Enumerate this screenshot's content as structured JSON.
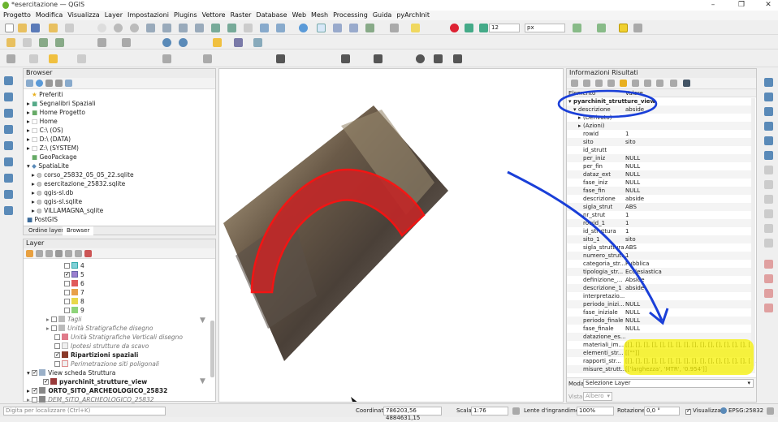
{
  "window": {
    "title": "*esercitazione — QGIS",
    "minimize": "–",
    "restore": "❐",
    "close": "✕"
  },
  "menu": [
    "Progetto",
    "Modifica",
    "Visualizza",
    "Layer",
    "Impostazioni",
    "Plugins",
    "Vettore",
    "Raster",
    "Database",
    "Web",
    "Mesh",
    "Processing",
    "Guida",
    "pyArchInit"
  ],
  "toolbar": {
    "font_size": "12",
    "unit": "px"
  },
  "browser": {
    "title": "Browser",
    "items": [
      {
        "label": "Preferiti",
        "icon": "star-icon"
      },
      {
        "label": "Segnalibri Spaziali",
        "icon": "bookmark-icon"
      },
      {
        "label": "Home Progetto",
        "icon": "home-project-icon"
      },
      {
        "label": "Home",
        "icon": "folder-icon"
      },
      {
        "label": "C:\\ (OS)",
        "icon": "drive-icon"
      },
      {
        "label": "D:\\ (DATA)",
        "icon": "drive-icon"
      },
      {
        "label": "Z:\\ (SYSTEM)",
        "icon": "drive-icon"
      },
      {
        "label": "GeoPackage",
        "icon": "geopackage-icon"
      },
      {
        "label": "SpatiaLite",
        "icon": "spatialite-icon"
      },
      {
        "label": "corso_25832_05_05_22.sqlite",
        "icon": "db-icon"
      },
      {
        "label": "esercitazione_25832.sqlite",
        "icon": "db-icon"
      },
      {
        "label": "qgis-sl.db",
        "icon": "db-icon"
      },
      {
        "label": "qgis-sl.sqlite",
        "icon": "db-icon"
      },
      {
        "label": "VILLAMAGNA_sqlite",
        "icon": "db-icon"
      },
      {
        "label": "PostGIS",
        "icon": "postgis-icon"
      }
    ],
    "tabs": [
      "Ordine layer",
      "Browser"
    ]
  },
  "layers": {
    "title": "Layer",
    "items": [
      {
        "label": "4",
        "color": "#7fd0d8",
        "checked": false
      },
      {
        "label": "5",
        "color": "#9b7fd0",
        "checked": true
      },
      {
        "label": "6",
        "color": "#e05a5a",
        "checked": false
      },
      {
        "label": "7",
        "color": "#e8a04a",
        "checked": false
      },
      {
        "label": "8",
        "color": "#e8d84a",
        "checked": false
      },
      {
        "label": "9",
        "color": "#8ed47a",
        "checked": false
      },
      {
        "label": "Tagli",
        "color": "#bbbbbb",
        "checked": false
      },
      {
        "label": "Unità Stratigrafiche disegno",
        "color": "#bbbbbb",
        "checked": false
      },
      {
        "label": "Unità Stratigrafiche Verticali disegno",
        "color": "#e07a8a",
        "checked": false
      },
      {
        "label": "Ipotesi strutture da scavo",
        "color": "#f0f0f0",
        "checked": false
      },
      {
        "label": "Ripartizioni spaziali",
        "color": "#8a3a2a",
        "checked": true
      },
      {
        "label": "Perimetrazione siti poligonali",
        "color": "#f0f0f0",
        "checked": false
      },
      {
        "label": "View scheda Struttura",
        "color": "#9ab0c8",
        "checked": true
      },
      {
        "label": "pyarchinit_strutture_view",
        "color": "#9a3a3a",
        "checked": true
      },
      {
        "label": "ORTO_SITO_ARCHEOLOGICO_25832",
        "color": "#888888",
        "checked": false
      },
      {
        "label": "DEM_SITO_ARCHEOLOGICO_25832",
        "color": "#888888",
        "checked": false
      }
    ]
  },
  "results": {
    "title": "Informazioni Risultati",
    "col_element": "Elemento",
    "col_value": "Valore",
    "layer": "pyarchinit_strutture_view",
    "first": {
      "k": "descrizione",
      "v": "abside"
    },
    "derived": "(Derivato)",
    "actions": "(Azioni)",
    "rows": [
      {
        "k": "rowid",
        "v": "1"
      },
      {
        "k": "sito",
        "v": "sito"
      },
      {
        "k": "id_strutt",
        "v": ""
      },
      {
        "k": "per_iniz",
        "v": "NULL"
      },
      {
        "k": "per_fin",
        "v": "NULL"
      },
      {
        "k": "dataz_ext",
        "v": "NULL"
      },
      {
        "k": "fase_iniz",
        "v": "NULL"
      },
      {
        "k": "fase_fin",
        "v": "NULL"
      },
      {
        "k": "descrizione",
        "v": "abside"
      },
      {
        "k": "sigla_strut",
        "v": "ABS"
      },
      {
        "k": "nr_strut",
        "v": "1"
      },
      {
        "k": "rowid_1",
        "v": "1"
      },
      {
        "k": "id_struttura",
        "v": "1"
      },
      {
        "k": "sito_1",
        "v": "sito"
      },
      {
        "k": "sigla_struttura",
        "v": "ABS"
      },
      {
        "k": "numero_strut...",
        "v": "1"
      },
      {
        "k": "categoria_str...",
        "v": "Pubblica"
      },
      {
        "k": "tipologia_str...",
        "v": "Ecclesiastica"
      },
      {
        "k": "definizione_...",
        "v": "Abside"
      },
      {
        "k": "descrizione_1",
        "v": "abside"
      },
      {
        "k": "interpretazio...",
        "v": ""
      },
      {
        "k": "periodo_inizi...",
        "v": "NULL"
      },
      {
        "k": "fase_iniziale",
        "v": "NULL"
      },
      {
        "k": "periodo_finale",
        "v": "NULL"
      },
      {
        "k": "fase_finale",
        "v": "NULL"
      },
      {
        "k": "datazione_es...",
        "v": ""
      },
      {
        "k": "materiali_im...",
        "v": "[[], [], [], [], [], [], [], [], [], [], [], [], [], [], [], [], [..."
      },
      {
        "k": "elementi_str...",
        "v": "[[\"\"]]"
      },
      {
        "k": "rapporti_str...",
        "v": "[[], [], [], [], [], [], [], [], [], [], [], [], [], [], [], [..."
      },
      {
        "k": "misure_strutt...",
        "v": "[['larghezza', 'MTR', '0.954']]"
      }
    ],
    "mode_label": "Moda",
    "mode_value": "Selezione Layer",
    "view_label": "Vista",
    "view_value": "Albero"
  },
  "status": {
    "search_placeholder": "Digita per localizzare (Ctrl+K)",
    "coord_label": "Coordinata",
    "coord_value": "786203,56 4884631,15",
    "scale_label": "Scala",
    "scale_value": "1:76",
    "magnifier_label": "Lente d'ingrandimento",
    "magnifier_value": "100%",
    "rotation_label": "Rotazione",
    "rotation_value": "0,0 °",
    "render_label": "Visualizza",
    "crs": "EPSG:25832"
  },
  "colors": {
    "highlight": "#f5f000",
    "annotation": "#1a3fd8",
    "feature": "#d42020"
  }
}
